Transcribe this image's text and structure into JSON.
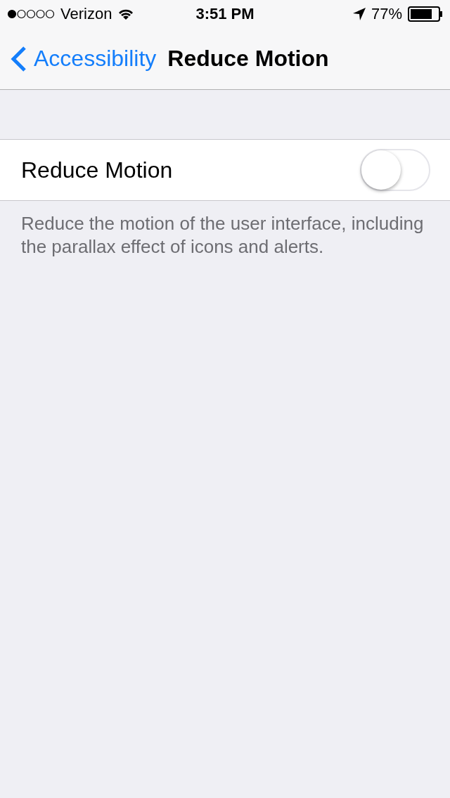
{
  "status_bar": {
    "carrier": "Verizon",
    "time": "3:51 PM",
    "battery": "77%"
  },
  "nav": {
    "back": "Accessibility",
    "title": "Reduce Motion"
  },
  "setting": {
    "label": "Reduce Motion",
    "on": false
  },
  "footer": "Reduce the motion of the user interface, including the parallax effect of icons and alerts."
}
